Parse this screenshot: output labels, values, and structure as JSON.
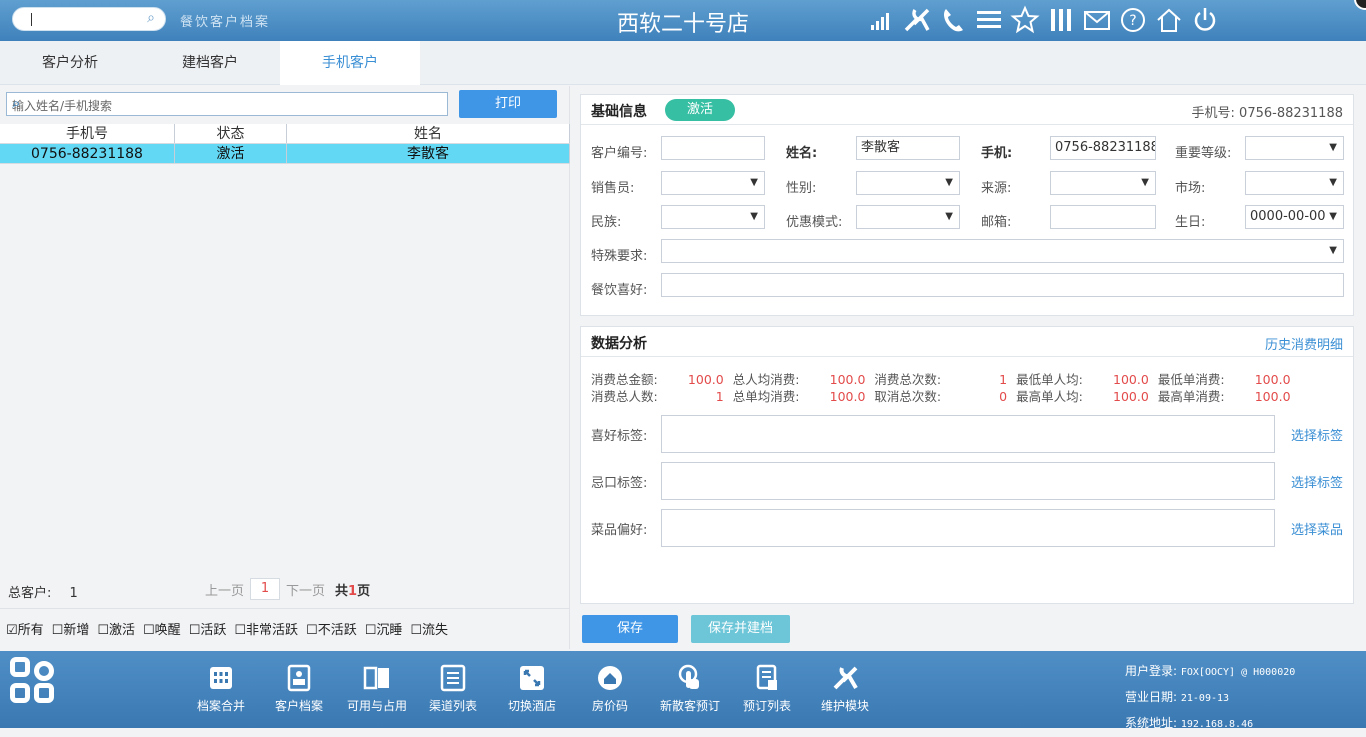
{
  "topbar": {
    "module": "餐饮客户档案",
    "store": "西软二十号店",
    "icons": [
      "signal-icon",
      "tools-icon",
      "phone-icon",
      "menu-icon",
      "star-icon",
      "columns-icon",
      "mail-icon",
      "help-icon",
      "home-icon",
      "power-icon"
    ]
  },
  "tabs": [
    "客户分析",
    "建档客户",
    "手机客户"
  ],
  "left": {
    "search_placeholder": "输入姓名/手机搜索",
    "print": "打印",
    "columns": [
      "手机号",
      "状态",
      "姓名"
    ],
    "rows": [
      {
        "phone": "0756-88231188",
        "status": "激活",
        "name": "李散客"
      }
    ],
    "total_label": "总客户:",
    "total": "1",
    "prev": "上一页",
    "page": "1",
    "next": "下一页",
    "pages_prefix": "共",
    "pages": "1",
    "pages_suffix": "页",
    "filters": [
      "所有",
      "新增",
      "激活",
      "唤醒",
      "活跃",
      "非常活跃",
      "不活跃",
      "沉睡",
      "流失"
    ]
  },
  "basic": {
    "title": "基础信息",
    "badge": "激活",
    "phone_label": "手机号:",
    "phone": "0756-88231188",
    "fields": {
      "customer_no": "客户编号:",
      "name": "姓名:",
      "name_val": "李散客",
      "mobile": "手机:",
      "mobile_val": "0756-88231188",
      "level": "重要等级:",
      "sales": "销售员:",
      "gender": "性别:",
      "source": "来源:",
      "market": "市场:",
      "ethnic": "民族:",
      "discount": "优惠模式:",
      "email": "邮箱:",
      "birthday": "生日:",
      "birthday_val": "0000-00-00",
      "special": "特殊要求:",
      "preference": "餐饮喜好:"
    }
  },
  "analysis": {
    "title": "数据分析",
    "history": "历史消费明细",
    "stats": [
      [
        "消费总金额:",
        "100.0",
        "总人均消费:",
        "100.0",
        "消费总次数:",
        "1",
        "最低单人均:",
        "100.0",
        "最低单消费:",
        "100.0"
      ],
      [
        "消费总人数:",
        "1",
        "总单均消费:",
        "100.0",
        "取消总次数:",
        "0",
        "最高单人均:",
        "100.0",
        "最高单消费:",
        "100.0"
      ]
    ],
    "like_tag": "喜好标签:",
    "avoid_tag": "忌口标签:",
    "dish_pref": "菜品偏好:",
    "choose_tag": "选择标签",
    "choose_dish": "选择菜品"
  },
  "actions": {
    "save": "保存",
    "save_archive": "保存并建档"
  },
  "bottom": {
    "items": [
      "档案合并",
      "客户档案",
      "可用与占用",
      "渠道列表",
      "切换酒店",
      "房价码",
      "新散客预订",
      "预订列表",
      "维护模块"
    ],
    "user_label": "用户登录:",
    "user": "FOX[OOCY] @ H000020",
    "date_label": "营业日期:",
    "date": "21-09-13",
    "addr_label": "系统地址:",
    "addr": "192.168.8.46"
  },
  "colors": {
    "accent": "#3f95e6",
    "active": "#36bfa3",
    "selected_row": "#62d8f4",
    "value_red": "#e34b4b"
  }
}
